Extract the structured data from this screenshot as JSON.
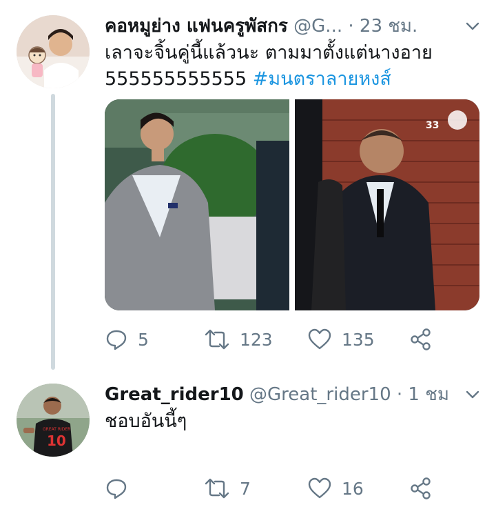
{
  "tweet1": {
    "display_name": "คอหมูย่าง แฟนครูพัสกร",
    "handle": "@G...",
    "separator": "·",
    "time": "23 ชม.",
    "text": "เลาจะจิ้นคู่นี้แล้วนะ ตามมาตั้งแต่นางอาย 555555555555 ",
    "hashtag": "#มนตราลายหงส์",
    "reply_count": "5",
    "retweet_count": "123",
    "like_count": "135"
  },
  "tweet2": {
    "display_name": "Great_rider10",
    "handle": "@Great_rider10",
    "separator": "·",
    "time": "1 ชม.",
    "text": "ชอบอันนี้ๆ",
    "reply_count": "",
    "retweet_count": "7",
    "like_count": "16"
  },
  "icons": {
    "reply": "reply-icon",
    "retweet": "retweet-icon",
    "like": "heart-icon",
    "share": "share-icon",
    "more": "chevron-down-icon"
  },
  "colors": {
    "link": "#1b95e0",
    "secondary": "#657786",
    "thread_line": "#cfd9de"
  },
  "media_badge": {
    "channel": "33"
  }
}
